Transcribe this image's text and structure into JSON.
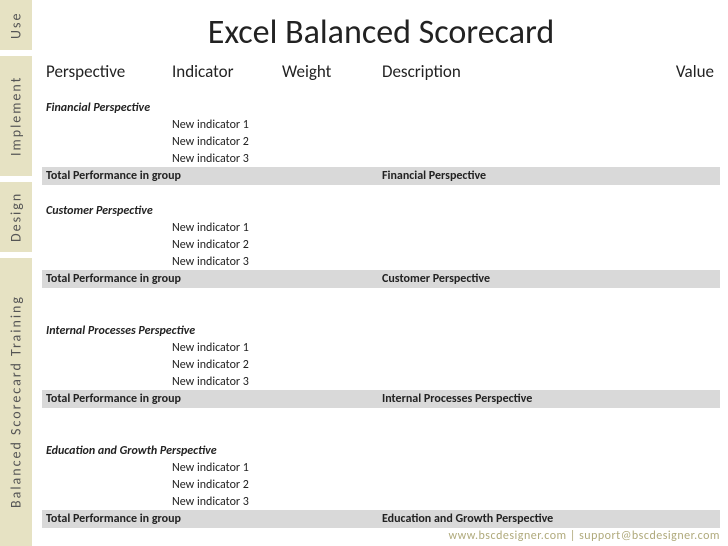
{
  "sidebar": {
    "use": "Use",
    "implement": "Implement",
    "design": "Design",
    "training": "Balanced Scorecard Training"
  },
  "title": "Excel Balanced Scorecard",
  "columns": {
    "perspective": "Perspective",
    "indicator": "Indicator",
    "weight": "Weight",
    "description": "Description",
    "value": "Value"
  },
  "groups": [
    {
      "name": "Financial Perspective",
      "indicators": [
        "New indicator 1",
        "New indicator 2",
        "New indicator 3"
      ],
      "total_label": "Total Performance in group",
      "total_desc": "Financial Perspective"
    },
    {
      "name": "Customer Perspective",
      "indicators": [
        "New indicator 1",
        "New indicator 2",
        "New indicator 3"
      ],
      "total_label": "Total Performance in group",
      "total_desc": "Customer Perspective"
    },
    {
      "name": "Internal Processes Perspective",
      "indicators": [
        "New indicator 1",
        "New indicator 2",
        "New indicator 3"
      ],
      "total_label": "Total Performance in group",
      "total_desc": "Internal Processes Perspective"
    },
    {
      "name": "Education and Growth Perspective",
      "indicators": [
        "New indicator 1",
        "New indicator 2",
        "New indicator 3"
      ],
      "total_label": "Total Performance in group",
      "total_desc": "Education and Growth Perspective"
    }
  ],
  "footer": "www.bscdesigner.com | support@bscdesigner.com"
}
